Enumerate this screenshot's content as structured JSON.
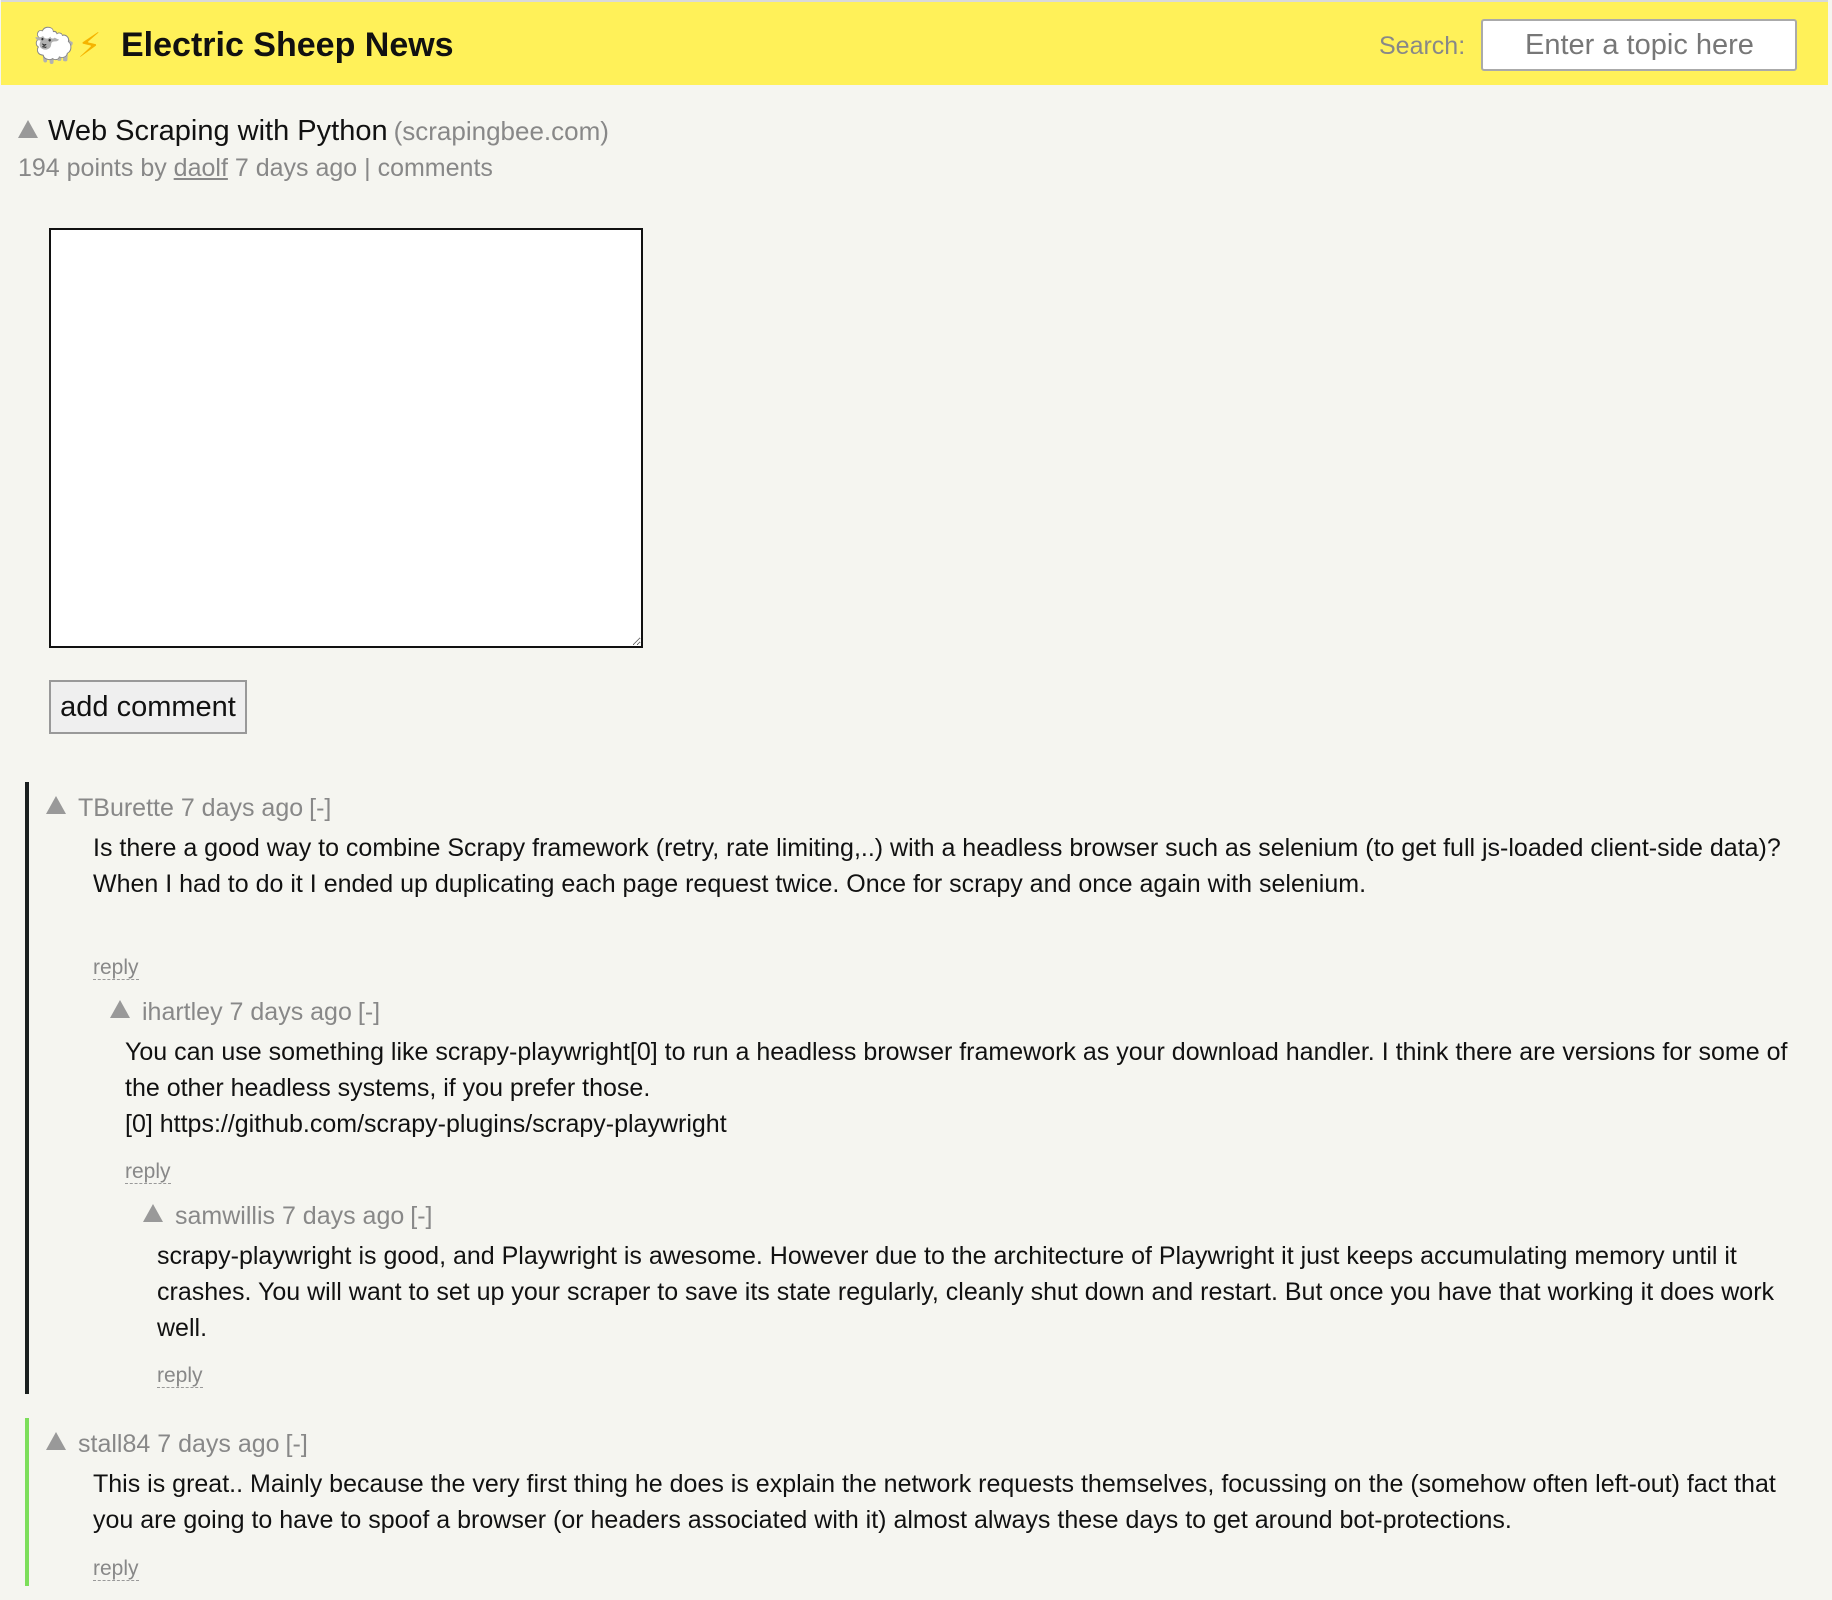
{
  "header": {
    "logo": "🐑",
    "bolt": "⚡",
    "title": "Electric Sheep News",
    "search_label": "Search:",
    "search_placeholder": "Enter a topic here"
  },
  "story": {
    "title": "Web Scraping with Python",
    "domain": "(scrapingbee.com)",
    "points": "194 points by",
    "user": "daolf",
    "age": "7 days ago",
    "separator": "|",
    "comments_link": "comments"
  },
  "form": {
    "submit_label": "add comment"
  },
  "comments": [
    {
      "user": "TBurette",
      "age": "7 days ago",
      "toggle": "[-]",
      "paragraphs": [
        "Is there a good way to combine Scrapy framework (retry, rate limiting,..) with a headless browser such as selenium (to get full js-loaded client-side data)?",
        "When I had to do it I ended up duplicating each page request twice. Once for scrapy and once again with selenium."
      ],
      "reply_label": "reply",
      "thread_color": "#1a1f1f"
    },
    {
      "user": "ihartley",
      "age": "7 days ago",
      "toggle": "[-]",
      "paragraphs": [
        "You can use something like scrapy-playwright[0] to run a headless browser framework as your download handler. I think there are versions for some of the other headless systems, if you prefer those.",
        "[0] https://github.com/scrapy-plugins/scrapy-playwright"
      ],
      "reply_label": "reply"
    },
    {
      "user": "samwillis",
      "age": "7 days ago",
      "toggle": "[-]",
      "paragraphs": [
        "scrapy-playwright is good, and Playwright is awesome. However due to the architecture of Playwright it just keeps accumulating memory until it crashes. You will want to set up your scraper to save its state regularly, cleanly shut down and restart. But once you have that working it does work well."
      ],
      "reply_label": "reply"
    },
    {
      "user": "stall84",
      "age": "7 days ago",
      "toggle": "[-]",
      "paragraphs": [
        "This is great.. Mainly because the very first thing he does is explain the network requests themselves, focussing on the (somehow often left-out) fact that you are going to have to spoof a browser (or headers associated with it) almost always these days to get around bot-protections."
      ],
      "reply_label": "reply",
      "thread_color": "#7cde5a"
    }
  ]
}
